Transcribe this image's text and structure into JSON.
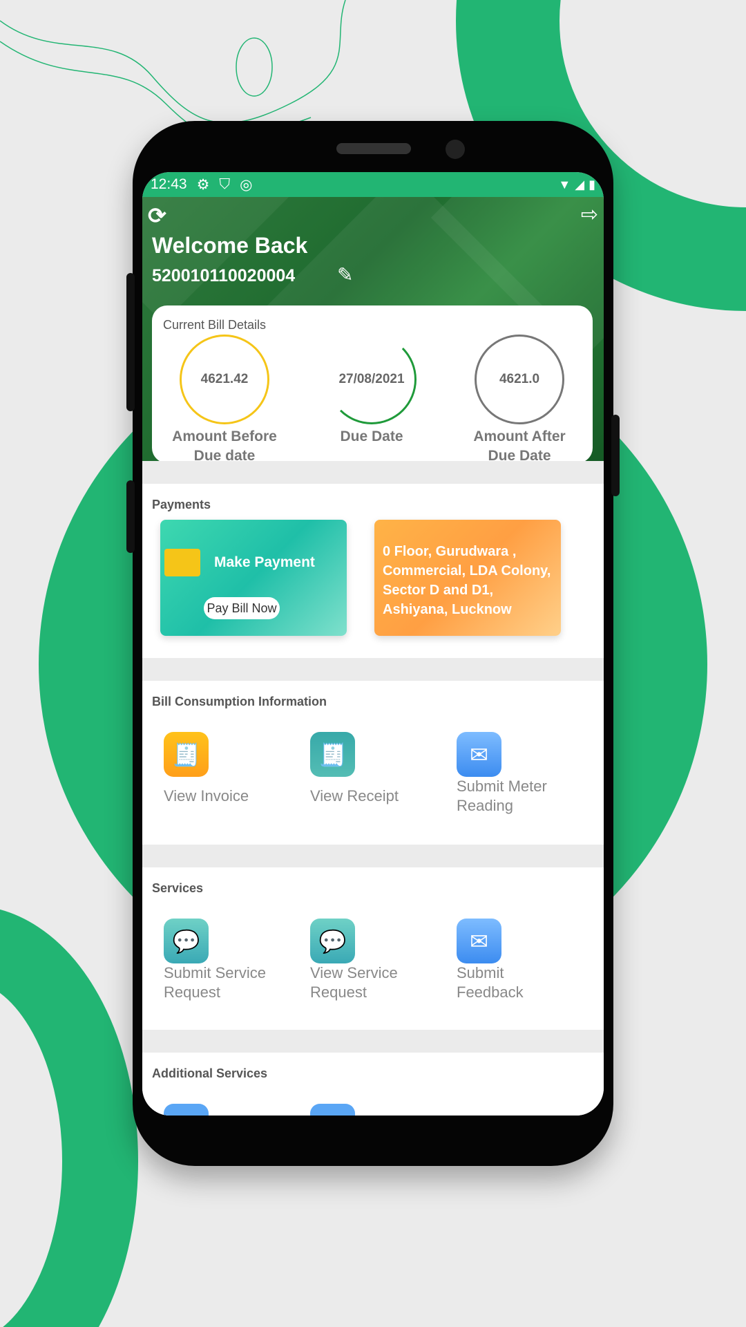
{
  "status_bar": {
    "time": "12:43",
    "icons": [
      "gear-icon",
      "shield-play-icon",
      "circle-a-icon"
    ],
    "right_icons": [
      "wifi-icon",
      "signal-icon",
      "battery-icon"
    ]
  },
  "header": {
    "welcome": "Welcome Back",
    "account_number": "520010110020004"
  },
  "bill": {
    "title": "Current Bill Details",
    "items": [
      {
        "value": "4621.42",
        "label_1": "Amount Before",
        "label_2": "Due date",
        "color": "#f5c518"
      },
      {
        "value": "27/08/2021",
        "label_1": "Due Date",
        "label_2": "",
        "color": "#1f9a3a"
      },
      {
        "value": "4621.0",
        "label_1": "Amount After",
        "label_2": "Due Date",
        "color": "#777777"
      }
    ]
  },
  "payments": {
    "title": "Payments",
    "make_payment": "Make Payment",
    "pay_bill_now": "Pay Bill Now",
    "address": "0 Floor, Gurudwara , Commercial, LDA Colony, Sector D and D1, Ashiyana, Lucknow"
  },
  "bill_consumption": {
    "title": "Bill Consumption Information",
    "items": [
      {
        "label": "View Invoice"
      },
      {
        "label": "View Receipt"
      },
      {
        "label": "Submit Meter Reading"
      }
    ]
  },
  "services": {
    "title": "Services",
    "items": [
      {
        "label": "Submit Service Request"
      },
      {
        "label": "View Service Request"
      },
      {
        "label": "Submit Feedback"
      }
    ]
  },
  "additional": {
    "title": "Additional Services"
  },
  "colors": {
    "brand_green": "#22b573"
  }
}
